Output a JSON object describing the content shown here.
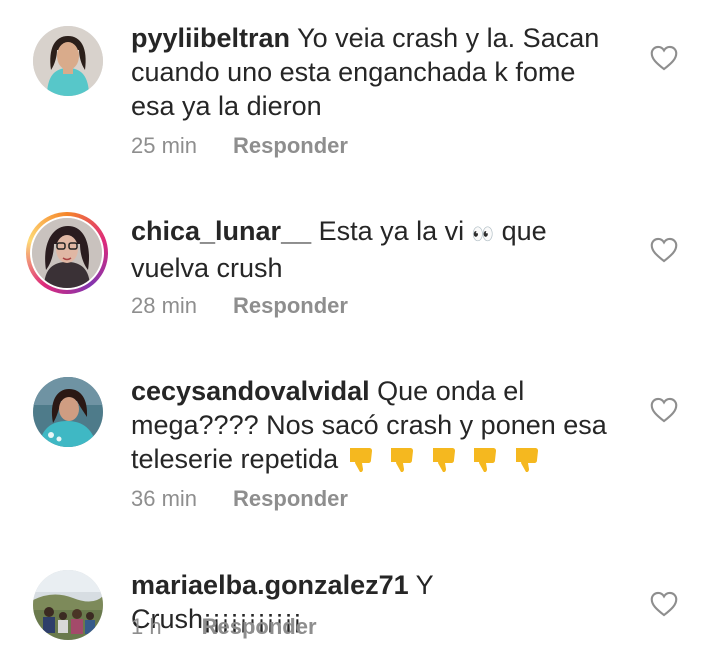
{
  "comments": [
    {
      "username": "pyyliibeltran",
      "text": "Yo veia crash y la. Sacan cuando uno esta enganchada k fome esa ya la dieron",
      "time": "25 min",
      "reply_label": "Responder",
      "has_story_ring": false
    },
    {
      "username": "chica_lunar__",
      "text_before": "Esta ya la vi",
      "eyes_emoji": "👀",
      "text_after": "que vuelva crush",
      "time": "28 min",
      "reply_label": "Responder",
      "has_story_ring": true
    },
    {
      "username": "cecysandovalvidal",
      "text": "Que onda el mega???? Nos sacó crash y ponen esa teleserie repetida",
      "emoji": "👎👎👎👎👎",
      "time": "36 min",
      "reply_label": "Responder",
      "has_story_ring": false
    },
    {
      "username": "mariaelba.gonzalez71",
      "text": "Y Crush¡¡¡¡¡¡¡¡¡¡¡",
      "time": "1 h",
      "reply_label": "Responder",
      "has_story_ring": false
    }
  ],
  "icons": {
    "like": "heart-outline-icon",
    "thumbs_down": "thumbs-down-emoji",
    "eyes": "eyes-emoji"
  },
  "colors": {
    "text": "#262626",
    "meta": "#8e8e8e",
    "background": "#ffffff",
    "emoji": "#f5b81f"
  }
}
